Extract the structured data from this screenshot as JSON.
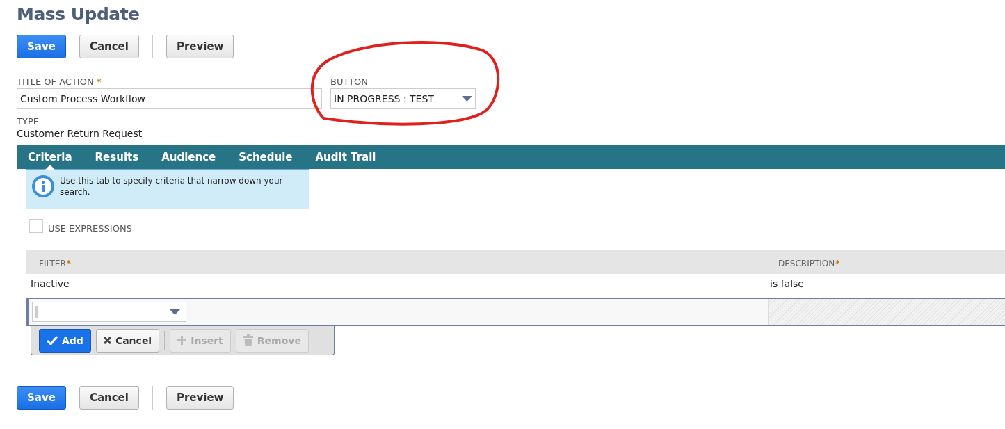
{
  "page_title": "Mass Update",
  "top_buttons": [
    {
      "label": "Save",
      "kind": "primary"
    },
    {
      "label": "Cancel",
      "kind": "default"
    },
    {
      "label": "Preview",
      "kind": "default"
    }
  ],
  "fields": {
    "title_of_action": {
      "label": "TITLE OF ACTION",
      "required_mark": "*",
      "value": "Custom Process Workflow"
    },
    "button": {
      "label": "BUTTON",
      "value": "IN PROGRESS : TEST"
    },
    "type": {
      "label": "TYPE",
      "value": "Customer Return Request"
    }
  },
  "tabs": [
    {
      "label": "Criteria",
      "selected": true
    },
    {
      "label": "Results",
      "selected": false
    },
    {
      "label": "Audience",
      "selected": false
    },
    {
      "label": "Schedule",
      "selected": false
    },
    {
      "label": "Audit Trail",
      "selected": false
    }
  ],
  "info_message": "Use this tab to specify criteria that narrow down your search.",
  "use_expressions": {
    "label": "USE EXPRESSIONS",
    "checked": false
  },
  "table": {
    "columns": [
      {
        "label": "FILTER",
        "required_mark": "*"
      },
      {
        "label": "DESCRIPTION",
        "required_mark": "*"
      }
    ],
    "rows": [
      [
        "Inactive",
        "is false"
      ]
    ],
    "edit_buttons": [
      {
        "label": "Add",
        "kind": "primary",
        "disabled": false
      },
      {
        "label": "Cancel",
        "kind": "default",
        "disabled": false
      },
      {
        "label": "Insert",
        "kind": "default",
        "disabled": true
      },
      {
        "label": "Remove",
        "kind": "default",
        "disabled": true
      }
    ]
  },
  "bottom_buttons": [
    {
      "label": "Save",
      "kind": "primary"
    },
    {
      "label": "Cancel",
      "kind": "default"
    },
    {
      "label": "Preview",
      "kind": "default"
    }
  ]
}
